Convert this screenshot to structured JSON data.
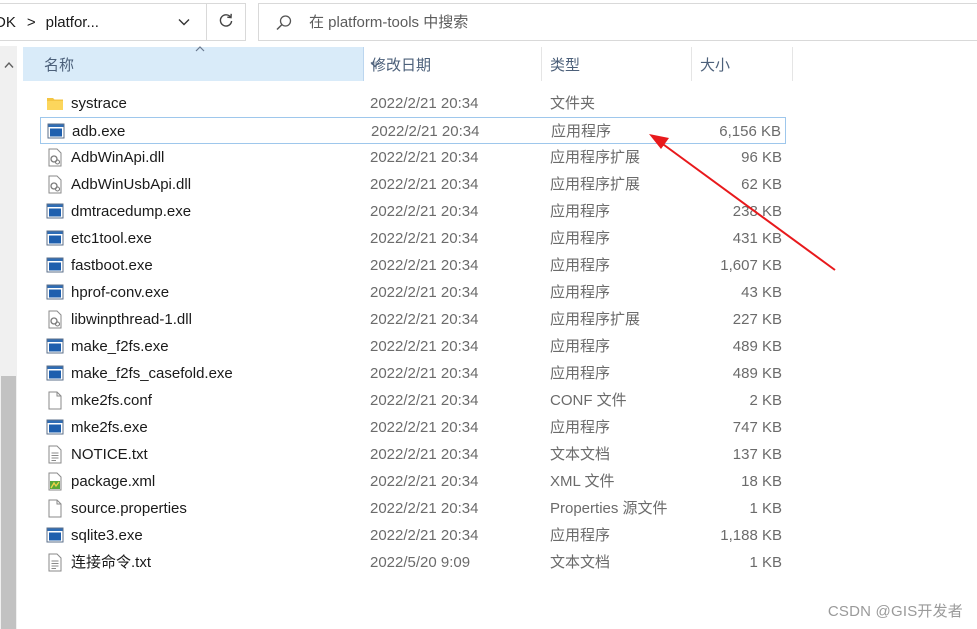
{
  "address_bar": {
    "segments": [
      "DK",
      "platfor..."
    ],
    "separator": ">"
  },
  "search": {
    "placeholder": "在 platform-tools 中搜索"
  },
  "columns": {
    "name": "名称",
    "date": "修改日期",
    "type": "类型",
    "size": "大小"
  },
  "files": [
    {
      "name": "systrace",
      "date": "2022/2/21 20:34",
      "type": "文件夹",
      "size": "",
      "icon": "folder-icon"
    },
    {
      "name": "adb.exe",
      "date": "2022/2/21 20:34",
      "type": "应用程序",
      "size": "6,156 KB",
      "icon": "exe-icon"
    },
    {
      "name": "AdbWinApi.dll",
      "date": "2022/2/21 20:34",
      "type": "应用程序扩展",
      "size": "96 KB",
      "icon": "dll-icon"
    },
    {
      "name": "AdbWinUsbApi.dll",
      "date": "2022/2/21 20:34",
      "type": "应用程序扩展",
      "size": "62 KB",
      "icon": "dll-icon"
    },
    {
      "name": "dmtracedump.exe",
      "date": "2022/2/21 20:34",
      "type": "应用程序",
      "size": "238 KB",
      "icon": "exe-icon"
    },
    {
      "name": "etc1tool.exe",
      "date": "2022/2/21 20:34",
      "type": "应用程序",
      "size": "431 KB",
      "icon": "exe-icon"
    },
    {
      "name": "fastboot.exe",
      "date": "2022/2/21 20:34",
      "type": "应用程序",
      "size": "1,607 KB",
      "icon": "exe-icon"
    },
    {
      "name": "hprof-conv.exe",
      "date": "2022/2/21 20:34",
      "type": "应用程序",
      "size": "43 KB",
      "icon": "exe-icon"
    },
    {
      "name": "libwinpthread-1.dll",
      "date": "2022/2/21 20:34",
      "type": "应用程序扩展",
      "size": "227 KB",
      "icon": "dll-icon"
    },
    {
      "name": "make_f2fs.exe",
      "date": "2022/2/21 20:34",
      "type": "应用程序",
      "size": "489 KB",
      "icon": "exe-icon"
    },
    {
      "name": "make_f2fs_casefold.exe",
      "date": "2022/2/21 20:34",
      "type": "应用程序",
      "size": "489 KB",
      "icon": "exe-icon"
    },
    {
      "name": "mke2fs.conf",
      "date": "2022/2/21 20:34",
      "type": "CONF 文件",
      "size": "2 KB",
      "icon": "blank-file-icon"
    },
    {
      "name": "mke2fs.exe",
      "date": "2022/2/21 20:34",
      "type": "应用程序",
      "size": "747 KB",
      "icon": "exe-icon"
    },
    {
      "name": "NOTICE.txt",
      "date": "2022/2/21 20:34",
      "type": "文本文档",
      "size": "137 KB",
      "icon": "text-file-icon"
    },
    {
      "name": "package.xml",
      "date": "2022/2/21 20:34",
      "type": "XML 文件",
      "size": "18 KB",
      "icon": "xml-file-icon"
    },
    {
      "name": "source.properties",
      "date": "2022/2/21 20:34",
      "type": "Properties 源文件",
      "size": "1 KB",
      "icon": "blank-file-icon"
    },
    {
      "name": "sqlite3.exe",
      "date": "2022/2/21 20:34",
      "type": "应用程序",
      "size": "1,188 KB",
      "icon": "exe-icon"
    },
    {
      "name": "连接命令.txt",
      "date": "2022/5/20 9:09",
      "type": "文本文档",
      "size": "1 KB",
      "icon": "text-file-icon"
    }
  ],
  "selected_index": 1,
  "colors": {
    "header_highlight": "#d9ebf9",
    "selection_border": "#9ec7ec",
    "annotation_arrow": "#e8191c",
    "folder": "#f4c542"
  },
  "watermark": "CSDN @GIS开发者"
}
